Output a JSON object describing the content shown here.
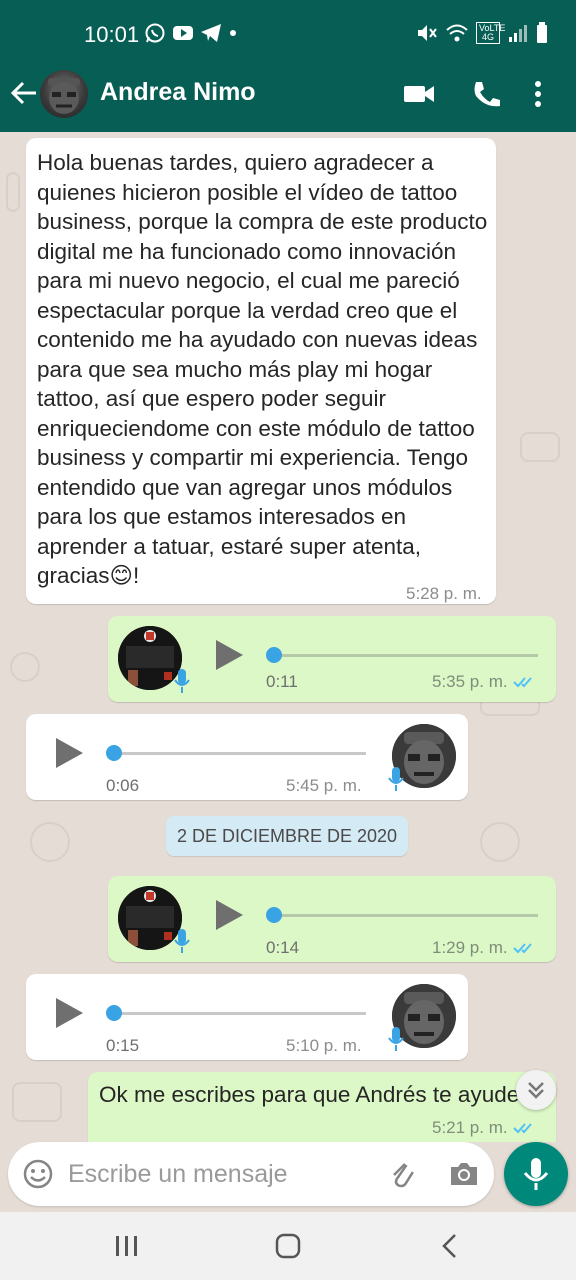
{
  "status_bar": {
    "time": "10:01",
    "left_icons": [
      "whatsapp-icon",
      "youtube-icon",
      "telegram-icon",
      "dot-icon"
    ],
    "right_icons": [
      "mute-icon",
      "wifi-icon",
      "volte-icon",
      "signal-icon",
      "battery-icon"
    ],
    "volte_text": "VoLTE 4G"
  },
  "header": {
    "contact_name": "Andrea Nimo",
    "icons": [
      "back-arrow-icon",
      "video-call-icon",
      "voice-call-icon",
      "more-options-icon"
    ]
  },
  "messages": [
    {
      "type": "text",
      "direction": "incoming",
      "text": "Hola buenas tardes, quiero agradecer a quienes hicieron posible el vídeo de tattoo business, porque la compra de este producto digital me ha funcionado como innovación para mi nuevo negocio, el cual me pareció espectacular porque la verdad creo que el contenido me ha ayudado con nuevas ideas para que sea mucho más play mi hogar tattoo, así que  espero poder seguir enriqueciendome con este módulo de tattoo business y compartir mi experiencia. Tengo entendido que van agregar unos módulos para los que estamos interesados en aprender a tatuar, estaré super atenta, gracias😊!",
      "time": "5:28 p. m."
    },
    {
      "type": "voice",
      "direction": "outgoing",
      "duration": "0:11",
      "time": "5:35 p. m.",
      "status": "read",
      "progress": 0.0
    },
    {
      "type": "voice",
      "direction": "incoming",
      "duration": "0:06",
      "time": "5:45 p. m.",
      "progress": 0.0
    },
    {
      "type": "date",
      "text": "2 DE DICIEMBRE DE 2020"
    },
    {
      "type": "voice",
      "direction": "outgoing",
      "duration": "0:14",
      "time": "1:29 p. m.",
      "status": "read",
      "progress": 0.0
    },
    {
      "type": "voice",
      "direction": "incoming",
      "duration": "0:15",
      "time": "5:10 p. m.",
      "progress": 0.0
    },
    {
      "type": "text",
      "direction": "outgoing",
      "text": "Ok me escribes para que Andrés te ayude",
      "time": "5:21 p. m.",
      "status": "read"
    }
  ],
  "composer": {
    "placeholder": "Escribe un mensaje",
    "icons": [
      "emoji-icon",
      "attach-icon",
      "camera-icon",
      "mic-icon"
    ]
  },
  "nav_bar": {
    "icons": [
      "recent-apps-icon",
      "home-icon",
      "back-icon"
    ]
  },
  "colors": {
    "header": "#075e54",
    "chat_bg": "#e5ddd5",
    "outgoing_bubble": "#dcf8c6",
    "incoming_bubble": "#ffffff",
    "accent": "#00897b",
    "read_ticks": "#4fc3f7"
  }
}
